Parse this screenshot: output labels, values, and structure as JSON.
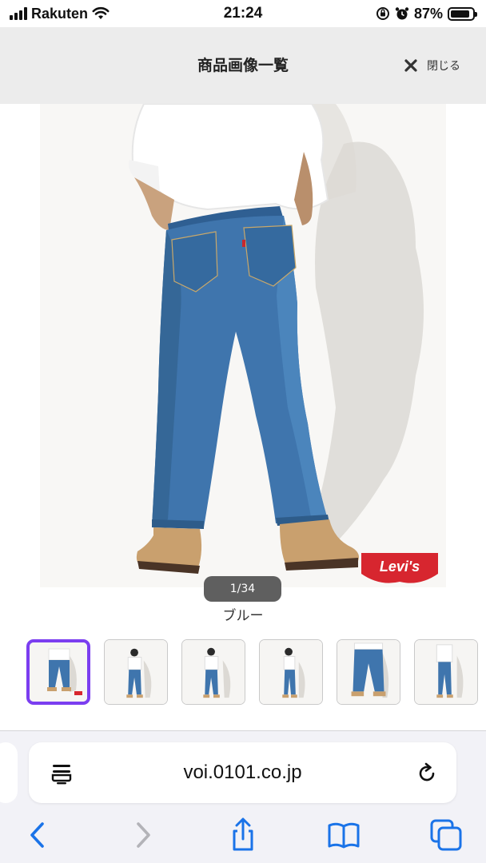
{
  "status_bar": {
    "carrier": "Rakuten",
    "time": "21:24",
    "battery_percent": "87%",
    "battery_level": 0.87,
    "icons": [
      "cellular-signal-icon",
      "wifi-icon",
      "screen-rotation-lock-icon",
      "alarm-icon",
      "battery-icon"
    ]
  },
  "header": {
    "title": "商品画像一覧",
    "close_label": "閉じる",
    "close_icon": "close-x-icon"
  },
  "gallery": {
    "counter": "1/34",
    "color_name": "ブルー",
    "brand_logo": "Levi's",
    "selected_index": 0,
    "thumbnails": [
      {
        "name": "thumbnail-1",
        "selected": true
      },
      {
        "name": "thumbnail-2",
        "selected": false
      },
      {
        "name": "thumbnail-3",
        "selected": false
      },
      {
        "name": "thumbnail-4",
        "selected": false
      },
      {
        "name": "thumbnail-5",
        "selected": false
      },
      {
        "name": "thumbnail-6",
        "selected": false
      }
    ]
  },
  "browser": {
    "url": "voi.0101.co.jp",
    "accent_color": "#1a73e8",
    "toolbar": [
      "back-icon",
      "forward-icon",
      "share-icon",
      "bookmarks-icon",
      "tabs-icon"
    ]
  }
}
